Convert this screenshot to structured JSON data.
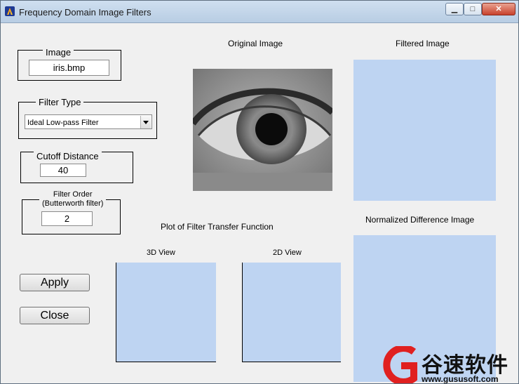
{
  "window": {
    "title": "Frequency Domain Image Filters",
    "controls": {
      "minimize": "▁",
      "maximize": "□",
      "close": "✕"
    }
  },
  "image_panel": {
    "legend": "Image",
    "value": "iris.bmp"
  },
  "filter_type_panel": {
    "legend": "Filter Type",
    "selected": "Ideal Low-pass Filter"
  },
  "cutoff_panel": {
    "legend": "Cutoff Distance",
    "value": "40"
  },
  "order_panel": {
    "legend_line1": "Filter Order",
    "legend_line2": "(Butterworth filter)",
    "value": "2"
  },
  "buttons": {
    "apply": "Apply",
    "close": "Close"
  },
  "labels": {
    "original_image": "Original Image",
    "filtered_image": "Filtered Image",
    "normalized_difference": "Normalized Difference Image",
    "transfer_function": "Plot of Filter Transfer Function",
    "view_3d": "3D View",
    "view_2d": "2D View"
  },
  "watermark": {
    "text": "谷速软件",
    "url": "www.gususoft.com"
  },
  "colors": {
    "axes_bg": "#bed4f2",
    "window_bg": "#f0f0f0",
    "watermark_red": "#e02020"
  }
}
